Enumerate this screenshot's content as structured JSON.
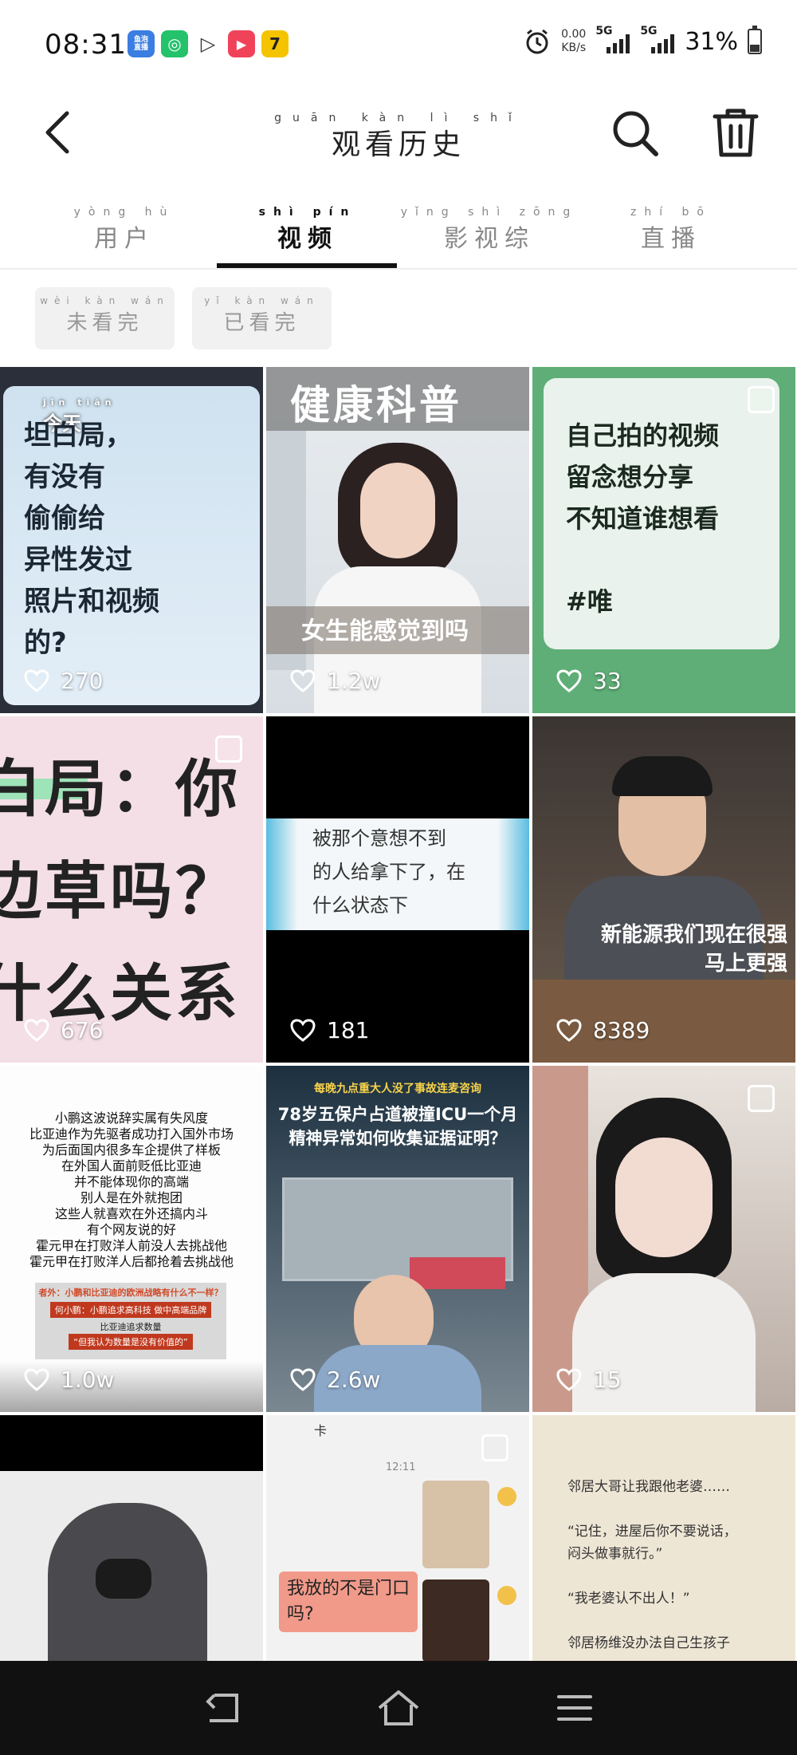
{
  "status_bar": {
    "time": "08:31",
    "net_speed_value": "0.00",
    "net_speed_unit": "KB/s",
    "sim1_label": "5G",
    "sim2_label": "5G",
    "battery": "31%",
    "battery_level": 0.31,
    "app_icons": [
      {
        "name": "yuqi-live-icon",
        "text": "鱼泡\n直播",
        "color": "#3b7de0"
      },
      {
        "name": "camera-app-icon",
        "text": "◎",
        "color": "#23c26b"
      },
      {
        "name": "play-app-icon",
        "text": "▷",
        "color": "#333333"
      },
      {
        "name": "video-app-icon",
        "text": "▶",
        "color": "#f0435a"
      },
      {
        "name": "qimao-app-icon",
        "text": "7",
        "color": "#f5c400"
      }
    ]
  },
  "header": {
    "title": "观看历史",
    "title_pinyin": "guān kàn lì shǐ"
  },
  "tabs": [
    {
      "label": "用户",
      "pinyin": "yòng hù",
      "active": false
    },
    {
      "label": "视频",
      "pinyin": "shì pín",
      "active": true
    },
    {
      "label": "影视综",
      "pinyin": "yǐng shì zōng",
      "active": false
    },
    {
      "label": "直播",
      "pinyin": "zhí bō",
      "active": false
    }
  ],
  "filters": [
    {
      "label": "未看完",
      "pinyin": "wèi kàn wán"
    },
    {
      "label": "已看完",
      "pinyin": "yǐ kàn wán"
    }
  ],
  "videos": [
    {
      "likes": "270",
      "overlay": "坦白局，\n有没有\n偷偷给\n异性发过\n照片和视频\n的?",
      "badge": "今天",
      "badge_pinyin": "jīn tiān"
    },
    {
      "likes": "1.2w",
      "top_text": "健康科普",
      "caption": "女生能感觉到吗"
    },
    {
      "likes": "33",
      "overlay": "自己拍的视频\n留念想分享\n不知道谁想看\n\n#唯"
    },
    {
      "likes": "676",
      "overlay": "白局：你\n边草吗？\n什么关系"
    },
    {
      "likes": "181",
      "overlay": "被那个意想不到\n的人给拿下了，在\n什么状态下"
    },
    {
      "likes": "8389",
      "caption": "新能源我们现在很强\n马上更强"
    },
    {
      "likes": "1.0w",
      "overlay": "小鹏这波说辞实属有失风度\n比亚迪作为先驱者成功打入国外市场\n为后面国内很多车企提供了样板\n在外国人面前贬低比亚迪\n并不能体现你的高端\n别人是在外就抱团\n这些人就喜欢在外还搞内斗\n有个网友说的好\n霍元甲在打败洋人前没人去挑战他\n霍元甲在打败洋人后都抢着去挑战他",
      "sub_title": "者外：小鹏和比亚迪的欧洲战略有什么不一样？",
      "sub_line": "何小鹏：小鹏追求高科技 做中高端品牌",
      "sub_line2": "比亚迪追求数量",
      "sub_quote": "“但我认为数量是没有价值的”"
    },
    {
      "likes": "2.6w",
      "top_text": "每晚九点重大人没了事故连麦咨询",
      "caption": "78岁五保户占道被撞ICU一个月\n精神异常如何收集证据证明？"
    },
    {
      "likes": "15"
    },
    {
      "likes": ""
    },
    {
      "likes": "",
      "chat_top": "卡",
      "chat_time": "12:11",
      "chat_bubble": "我放的不是门口\n吗?"
    },
    {
      "likes": "",
      "overlay": "邻居大哥让我跟他老婆……\n\n“记住，进屋后你不要说话，\n闷头做事就行。”\n\n“我老婆认不出人！”\n\n邻居杨维没办法自己生孩子"
    }
  ],
  "colors": {
    "accent": "#111111",
    "tab_inactive": "#888888",
    "chip_bg": "#f1f1f1",
    "navbar_bg": "#111111",
    "highlight_green": "#7de0a6",
    "highlight_blue": "#7fd6f0"
  }
}
